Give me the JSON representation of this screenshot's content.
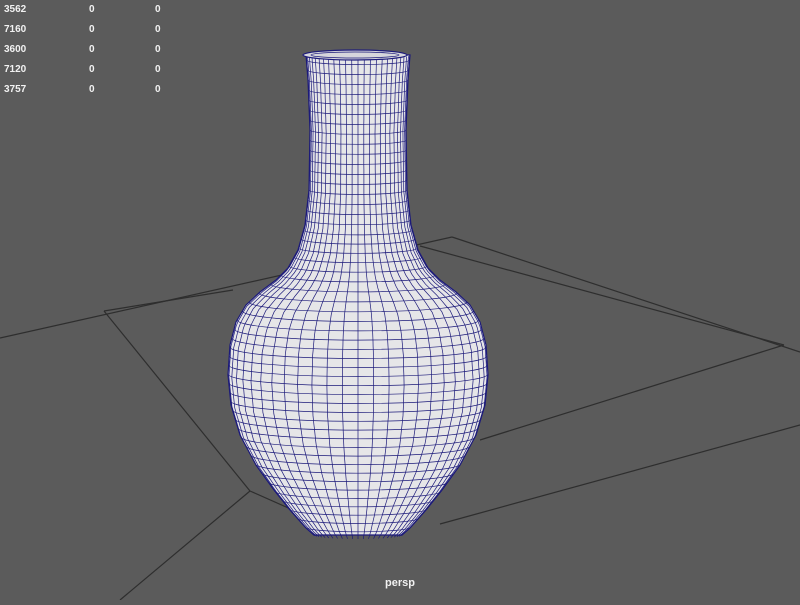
{
  "hud": {
    "rows": [
      [
        "3562",
        "0",
        "0"
      ],
      [
        "7160",
        "0",
        "0"
      ],
      [
        "3600",
        "0",
        "0"
      ],
      [
        "7120",
        "0",
        "0"
      ],
      [
        "3757",
        "0",
        "0"
      ]
    ]
  },
  "viewport": {
    "camera": "persp"
  },
  "colors": {
    "background": "#5b5b5b",
    "grid": "#2e2e2e",
    "mesh_fill": "#e6e6e8",
    "wireframe": "#1c1a7a",
    "hud_text": "#f2f2f2"
  },
  "icons": {
    "model": "vase-mesh-icon"
  }
}
